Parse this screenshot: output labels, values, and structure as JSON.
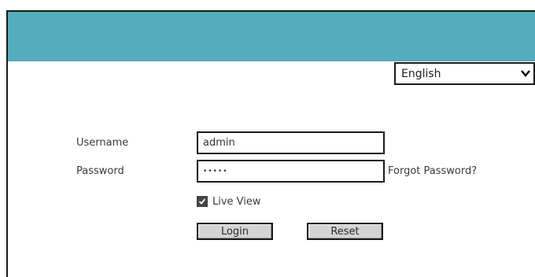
{
  "header": {
    "color": "#55acba"
  },
  "language": {
    "selected": "English",
    "icon": "chevron-down-icon"
  },
  "form": {
    "username_label": "Username",
    "username_value": "admin",
    "password_label": "Password",
    "password_value": "•••••",
    "forgot_password": "Forgot Password?",
    "live_view_label": "Live View",
    "live_view_checked": true,
    "login_button": "Login",
    "reset_button": "Reset"
  }
}
